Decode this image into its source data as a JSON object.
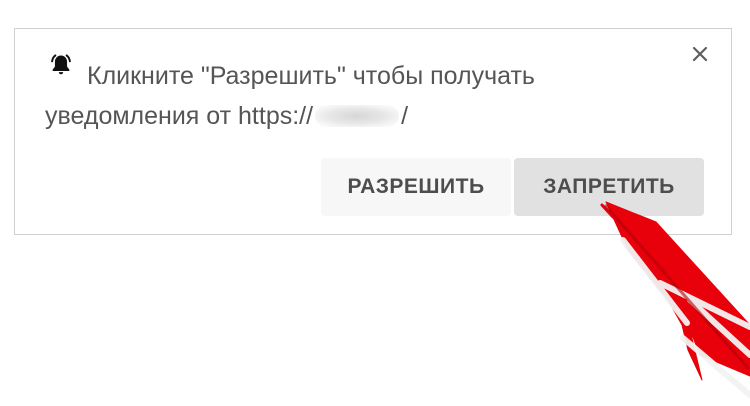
{
  "notification": {
    "message_prefix": "Кликните \"Разрешить\" чтобы получать уведомления от https://",
    "message_suffix": "/",
    "allow_label": "РАЗРЕШИТЬ",
    "block_label": "ЗАПРЕТИТЬ",
    "close_label": "×",
    "icon": "bell-icon"
  },
  "colors": {
    "text": "#555555",
    "allow_button_bg": "#f7f7f7",
    "block_button_bg": "#e1e1e1",
    "arrow": "#e8000b"
  }
}
